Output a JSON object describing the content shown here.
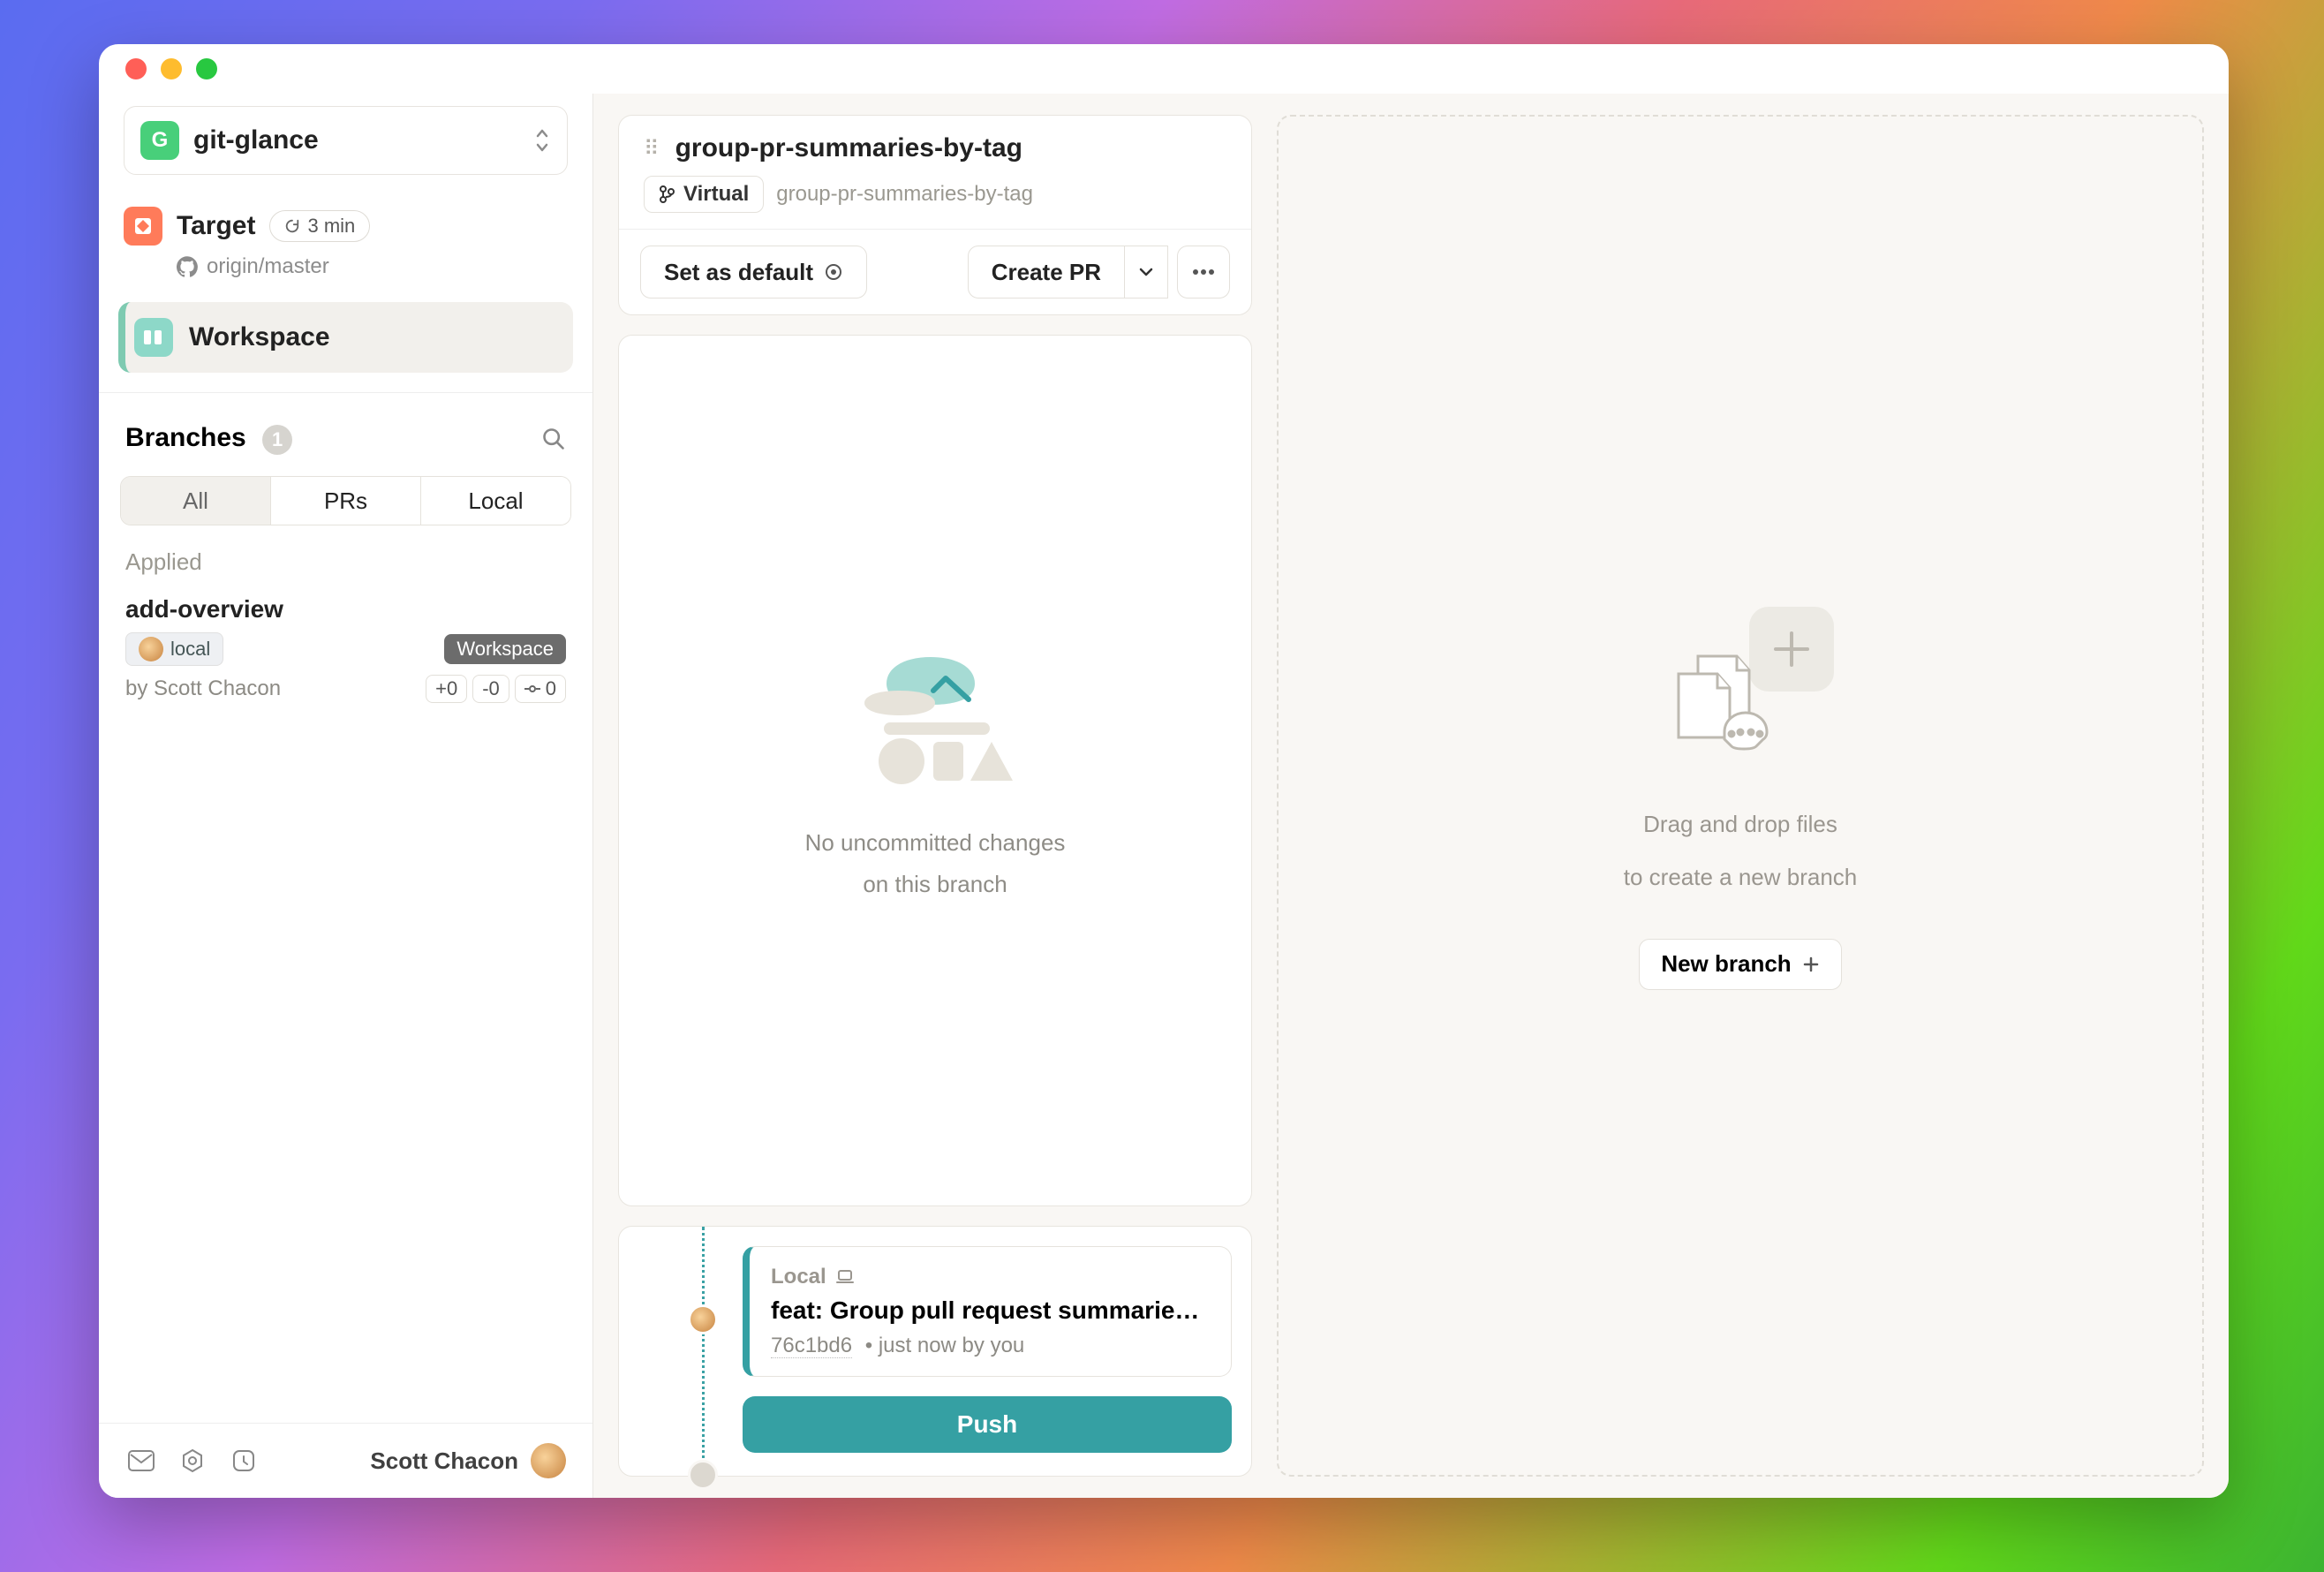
{
  "project": {
    "initial": "G",
    "name": "git-glance"
  },
  "target": {
    "label": "Target",
    "time_badge": "3 min",
    "remote": "origin/master"
  },
  "nav": {
    "workspace_label": "Workspace"
  },
  "branches": {
    "header": "Branches",
    "count": "1",
    "tabs": {
      "all": "All",
      "prs": "PRs",
      "local": "Local"
    },
    "section_label": "Applied",
    "item": {
      "name": "add-overview",
      "local_tag": "local",
      "workspace_tag": "Workspace",
      "author_line": "by Scott Chacon",
      "plus": "+0",
      "minus": "-0",
      "ahead": "0"
    }
  },
  "user": {
    "name": "Scott Chacon"
  },
  "lane": {
    "title": "group-pr-summaries-by-tag",
    "virtual_tag": "Virtual",
    "subtitle": "group-pr-summaries-by-tag",
    "set_default": "Set as default",
    "create_pr": "Create PR",
    "empty_line1": "No uncommitted changes",
    "empty_line2": "on this branch"
  },
  "commit": {
    "location": "Local",
    "title": "feat: Group pull request summaries b...",
    "sha": "76c1bd6",
    "meta": "just now by you",
    "push_label": "Push"
  },
  "drop": {
    "line1": "Drag and drop files",
    "line2": "to create a new branch",
    "new_branch": "New branch"
  }
}
